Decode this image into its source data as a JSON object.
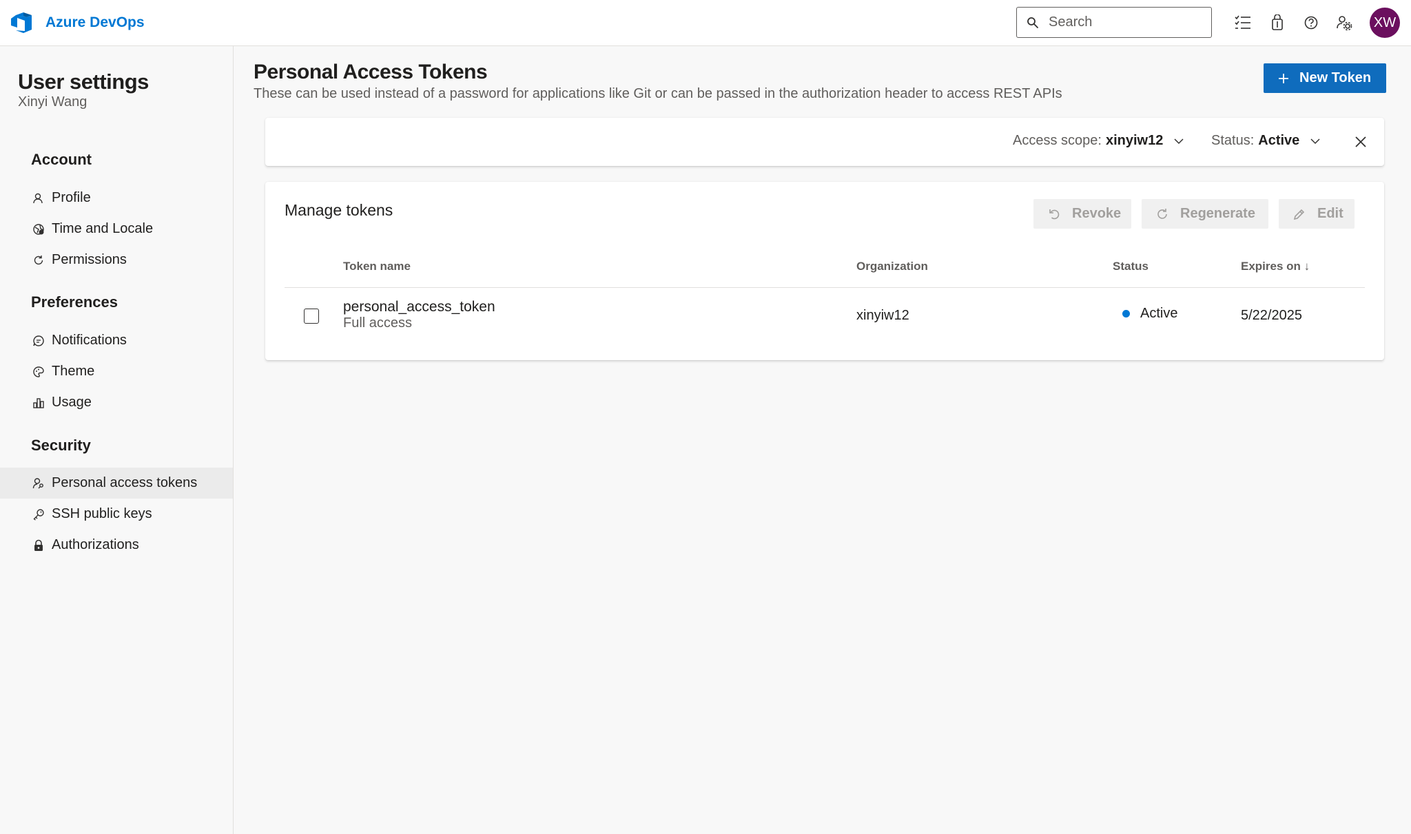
{
  "header": {
    "app_name": "Azure DevOps",
    "search_placeholder": "Search",
    "avatar_initials": "XW",
    "brand_color": "#0078d4",
    "avatar_color": "#6b0f5e",
    "icons": [
      "work-items-icon",
      "marketplace-icon",
      "help-icon",
      "user-settings-icon"
    ]
  },
  "sidebar": {
    "title": "User settings",
    "user_name": "Xinyi Wang",
    "sections": {
      "account": {
        "label": "Account",
        "items": [
          {
            "label": "Profile",
            "icon": "profile-icon"
          },
          {
            "label": "Time and Locale",
            "icon": "globe-icon"
          },
          {
            "label": "Permissions",
            "icon": "refresh-icon"
          }
        ]
      },
      "preferences": {
        "label": "Preferences",
        "items": [
          {
            "label": "Notifications",
            "icon": "chat-icon"
          },
          {
            "label": "Theme",
            "icon": "palette-icon"
          },
          {
            "label": "Usage",
            "icon": "chart-icon"
          }
        ]
      },
      "security": {
        "label": "Security",
        "items": [
          {
            "label": "Personal access tokens",
            "icon": "user-key-icon",
            "selected": true
          },
          {
            "label": "SSH public keys",
            "icon": "key-icon"
          },
          {
            "label": "Authorizations",
            "icon": "lock-icon"
          }
        ]
      }
    }
  },
  "main": {
    "title": "Personal Access Tokens",
    "description": "These can be used instead of a password for applications like Git or can be passed in the authorization header to access REST APIs",
    "new_token_label": "New Token",
    "accent_color": "#0f6cbd",
    "filters": {
      "scope_label": "Access scope:",
      "scope_value": "xinyiw12",
      "status_label": "Status:",
      "status_value": "Active"
    },
    "card": {
      "title": "Manage tokens",
      "actions": {
        "revoke": "Revoke",
        "regenerate": "Regenerate",
        "edit": "Edit"
      },
      "columns": {
        "name": "Token name",
        "organization": "Organization",
        "status": "Status",
        "expires": "Expires on ↓"
      },
      "rows": [
        {
          "name": "personal_access_token",
          "scope": "Full access",
          "organization": "xinyiw12",
          "status": "Active",
          "status_color": "#0078d4",
          "expires": "5/22/2025",
          "checked": false
        }
      ]
    }
  }
}
